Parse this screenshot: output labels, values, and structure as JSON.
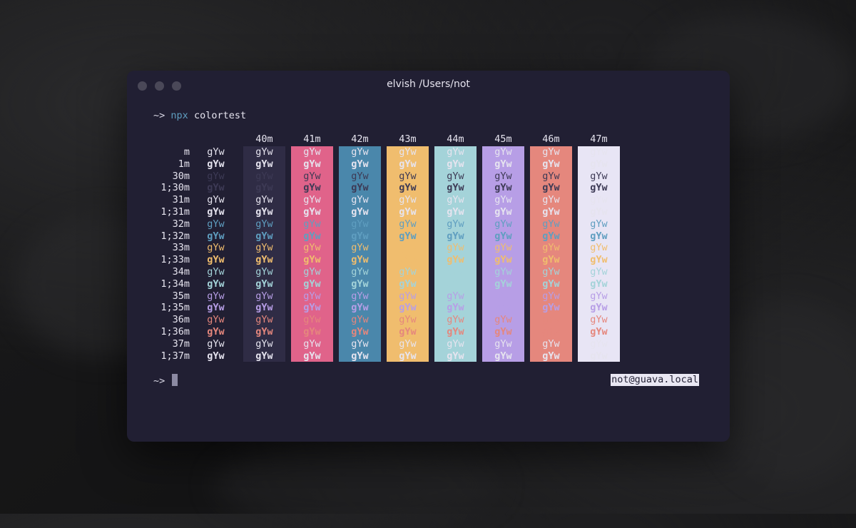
{
  "window": {
    "title": "elvish /Users/not"
  },
  "command": {
    "prompt": "~>",
    "program": "npx",
    "args": "colortest"
  },
  "next_prompt": {
    "prompt": "~>"
  },
  "hostname": "not@guava.local",
  "sample_text": "gYw",
  "columns": [
    "40m",
    "41m",
    "42m",
    "43m",
    "44m",
    "45m",
    "46m",
    "47m"
  ],
  "rows": [
    "m",
    "1m",
    "30m",
    "1;30m",
    "31m",
    "1;31m",
    "32m",
    "1;32m",
    "33m",
    "1;33m",
    "34m",
    "1;34m",
    "35m",
    "1;35m",
    "36m",
    "1;36m",
    "37m",
    "1;37m"
  ],
  "palette": {
    "bg_default": "#211f33",
    "bg40": "#2f2c45",
    "bg41": "#e0638a",
    "bg42": "#4a87ab",
    "bg43": "#f0bd6e",
    "bg44": "#a4d3d9",
    "bg45": "#b79ee6",
    "bg46": "#e5877d",
    "bg47": "#e8e5f5",
    "fg_default": "#e6e4ef",
    "fg30": "#3d3a55",
    "fg31": "#e0638a",
    "fg32": "#5f9ec0",
    "fg33": "#f0bd6e",
    "fg34": "#a4d3d9",
    "fg35": "#b79ee6",
    "fg36": "#e5877d",
    "fg37": "#e6e4ef"
  }
}
